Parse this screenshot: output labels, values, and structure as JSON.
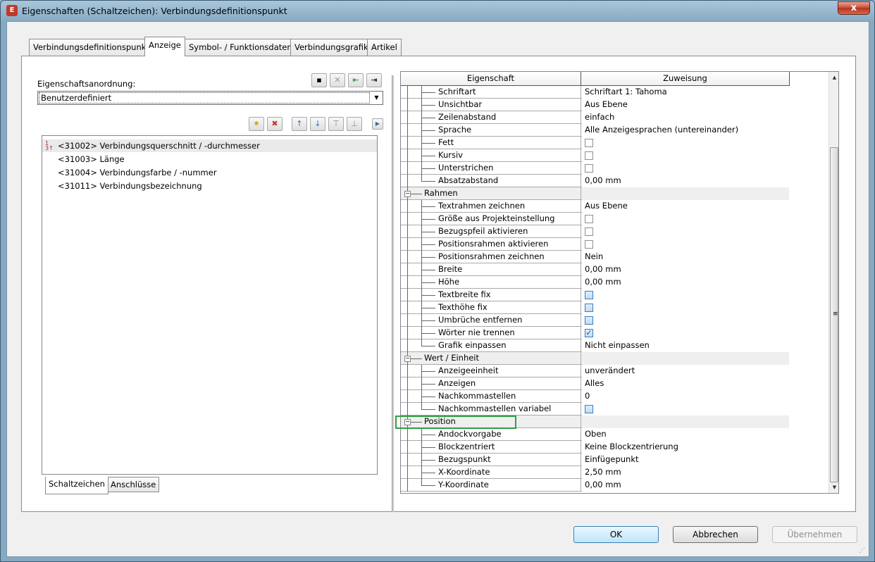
{
  "window": {
    "title": "Eigenschaften (Schaltzeichen): Verbindungsdefinitionspunkt",
    "close_label": "x"
  },
  "tabs": [
    {
      "label": "Verbindungsdefinitionspunkt",
      "active": false
    },
    {
      "label": "Anzeige",
      "active": true
    },
    {
      "label": "Symbol- / Funktionsdaten",
      "active": false
    },
    {
      "label": "Verbindungsgrafik",
      "active": false
    },
    {
      "label": "Artikel",
      "active": false
    }
  ],
  "left": {
    "arrangement_label": "Eigenschaftsanordnung:",
    "arrangement_value": "Benutzerdefiniert",
    "list_items": [
      "<31002> Verbindungsquerschnitt / -durchmesser",
      "<31003> Länge",
      "<31004> Verbindungsfarbe / -nummer",
      "<31011> Verbindungsbezeichnung"
    ],
    "bottom_tabs": [
      "Schaltzeichen",
      "Anschlüsse"
    ]
  },
  "grid": {
    "headers": {
      "name": "Eigenschaft",
      "value": "Zuweisung"
    },
    "rows": [
      {
        "name": "Schriftart",
        "value": "Schriftart 1: Tahoma",
        "type": "text"
      },
      {
        "name": "Unsichtbar",
        "value": "Aus Ebene",
        "type": "text"
      },
      {
        "name": "Zeilenabstand",
        "value": "einfach",
        "type": "text"
      },
      {
        "name": "Sprache",
        "value": "Alle Anzeigesprachen (untereinander)",
        "type": "text"
      },
      {
        "name": "Fett",
        "value": "",
        "type": "check"
      },
      {
        "name": "Kursiv",
        "value": "",
        "type": "check"
      },
      {
        "name": "Unterstrichen",
        "value": "",
        "type": "check"
      },
      {
        "name": "Absatzabstand",
        "value": "0,00 mm",
        "type": "text"
      },
      {
        "name": "Rahmen",
        "value": "",
        "type": "category"
      },
      {
        "name": "Textrahmen zeichnen",
        "value": "Aus Ebene",
        "type": "text"
      },
      {
        "name": "Größe aus Projekteinstellung",
        "value": "",
        "type": "check"
      },
      {
        "name": "Bezugspfeil aktivieren",
        "value": "",
        "type": "check"
      },
      {
        "name": "Positionsrahmen aktivieren",
        "value": "",
        "type": "check"
      },
      {
        "name": "Positionsrahmen zeichnen",
        "value": "Nein",
        "type": "text"
      },
      {
        "name": "Breite",
        "value": "0,00 mm",
        "type": "text"
      },
      {
        "name": "Höhe",
        "value": "0,00 mm",
        "type": "text"
      },
      {
        "name": "Textbreite fix",
        "value": "",
        "type": "check-blue"
      },
      {
        "name": "Texthöhe fix",
        "value": "",
        "type": "check-blue"
      },
      {
        "name": "Umbrüche entfernen",
        "value": "",
        "type": "check-blue"
      },
      {
        "name": "Wörter nie trennen",
        "value": "",
        "type": "check-blue-checked"
      },
      {
        "name": "Grafik einpassen",
        "value": "Nicht einpassen",
        "type": "text"
      },
      {
        "name": "Wert / Einheit",
        "value": "",
        "type": "category"
      },
      {
        "name": "Anzeigeeinheit",
        "value": "unverändert",
        "type": "text"
      },
      {
        "name": "Anzeigen",
        "value": "Alles",
        "type": "text"
      },
      {
        "name": "Nachkommastellen",
        "value": "0",
        "type": "text"
      },
      {
        "name": "Nachkommastellen variabel",
        "value": "",
        "type": "check-blue"
      },
      {
        "name": "Position",
        "value": "",
        "type": "category"
      },
      {
        "name": "Andockvorgabe",
        "value": "Oben",
        "type": "text"
      },
      {
        "name": "Blockzentriert",
        "value": "Keine Blockzentrierung",
        "type": "text"
      },
      {
        "name": "Bezugspunkt",
        "value": "Einfügepunkt",
        "type": "text"
      },
      {
        "name": "X-Koordinate",
        "value": "2,50 mm",
        "type": "text"
      },
      {
        "name": "Y-Koordinate",
        "value": "0,00 mm",
        "type": "text"
      }
    ]
  },
  "buttons": {
    "ok": "OK",
    "cancel": "Abbrechen",
    "apply": "Übernehmen"
  },
  "colors": {
    "highlight": "#2ea043",
    "title_gradient": "#86aac3"
  }
}
